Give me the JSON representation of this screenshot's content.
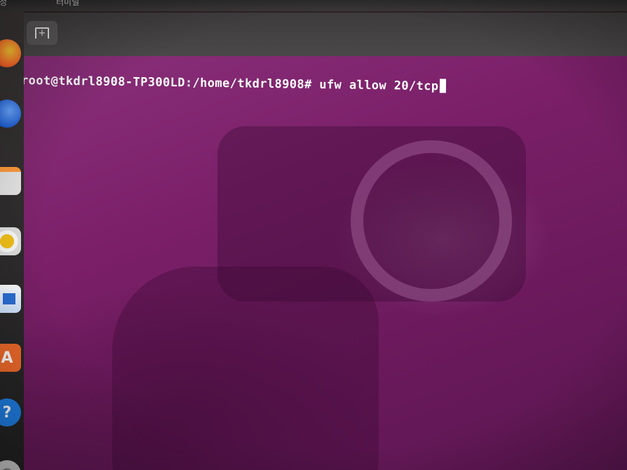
{
  "top_panel": {
    "left_text": "설정",
    "mid_text": "터미널"
  },
  "dock": {
    "items": [
      {
        "name": "firefox-icon"
      },
      {
        "name": "thunderbird-icon"
      },
      {
        "name": "files-icon"
      },
      {
        "name": "rhythmbox-icon"
      },
      {
        "name": "libreoffice-writer-icon"
      },
      {
        "name": "software-store-icon",
        "glyph": "A"
      },
      {
        "name": "help-icon",
        "glyph": "?"
      },
      {
        "name": "settings-icon"
      }
    ]
  },
  "terminal": {
    "new_tab_glyph": "+",
    "prompt": "root@tkdrl8908-TP300LD:/home/tkdrl8908#",
    "command": " ufw allow 20/tcp"
  },
  "colors": {
    "terminal_bg": "#7a1f68",
    "titlebar_bg": "#444142",
    "text": "#ffffff"
  }
}
